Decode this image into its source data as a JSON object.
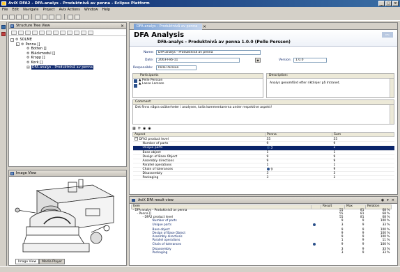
{
  "window": {
    "title": "AviX DFA2 - DFA-analys - Produktnivå av penna - Eclipse Platform",
    "controls": [
      "_",
      "□",
      "×"
    ]
  },
  "menu": {
    "items": [
      "File",
      "Edit",
      "Navigate",
      "Project",
      "Avix Actions",
      "Window",
      "Help"
    ]
  },
  "structure_view": {
    "title": "Structure Tree View",
    "tree": [
      {
        "label": "SOLME",
        "level": 0,
        "expander": "-"
      },
      {
        "label": "Penna []",
        "level": 1,
        "expander": "-"
      },
      {
        "label": "Botten []",
        "level": 2,
        "expander": ""
      },
      {
        "label": "Bläckmodul []",
        "level": 2,
        "expander": ""
      },
      {
        "label": "Kropp []",
        "level": 2,
        "expander": ""
      },
      {
        "label": "Kork []",
        "level": 2,
        "expander": ""
      },
      {
        "label": "DFA-analys - Produktnivå av penna",
        "level": 2,
        "expander": "",
        "selected": true
      }
    ]
  },
  "image_view": {
    "title": "Image View",
    "tabs": [
      "Image View",
      "Media Player"
    ]
  },
  "editor": {
    "tab_label": "DFA-analys - Produktnivå av penna",
    "heading": "DFA Analysis",
    "subheading": "DFA-analys - Produktnivå av penna 1.0.0 (Pelle Persson)",
    "logo_text": "DFA",
    "name_label": "Name:",
    "name_value": "DFA-analys - Produktnivå av penna",
    "date_label": "Date:",
    "date_value": "2003-Feb-11",
    "version_label": "Version:",
    "version_value": "1.0.0",
    "responsible_label": "Responsible:",
    "responsible_value": "Pelle Persson",
    "participants_label": "Participants",
    "participants": [
      "Pelle Persson",
      "Lasse Larsson"
    ],
    "description_label": "Description:",
    "description_value": "Analys genomförd efter riktlinjer på Intranet.",
    "comment_label": "Comment:",
    "comment_value": "Det finns några osäkerheter i analysen, kolla kommentarerna under respektive aspekt!",
    "aspect_table": {
      "columns": [
        "Aspect",
        "Penna",
        "Sum"
      ],
      "rows": [
        {
          "aspect": "DFA2 product level",
          "penna": "55",
          "sum": "55",
          "expander": "-"
        },
        {
          "aspect": "Number of parts",
          "penna": "9",
          "sum": "9"
        },
        {
          "aspect": "Unique parts",
          "penna": "3",
          "sum": "3",
          "selected": true,
          "marker": true
        },
        {
          "aspect": "Base object",
          "penna": "1",
          "sum": "1"
        },
        {
          "aspect": "Design of Base Object",
          "penna": "9",
          "sum": "9"
        },
        {
          "aspect": "Assembly directions",
          "penna": "9",
          "sum": "9"
        },
        {
          "aspect": "Parallel operations",
          "penna": "1",
          "sum": "1"
        },
        {
          "aspect": "Chain of tolerances",
          "penna": "9",
          "sum": "9",
          "marker": true
        },
        {
          "aspect": "Disassembly",
          "penna": "3",
          "sum": "3"
        },
        {
          "aspect": "Packaging",
          "penna": "3",
          "sum": "3"
        }
      ]
    }
  },
  "result_view": {
    "title": "AviX DFA result view",
    "columns": [
      "Item",
      "",
      "Result",
      "Max",
      "Relation"
    ],
    "rows": [
      {
        "item": "DFA-analys - Produktnivå av penna",
        "indent": 0,
        "result": "55",
        "max": "81",
        "relation": "68 %",
        "expander": "-"
      },
      {
        "item": "Penna []",
        "indent": 1,
        "result": "55",
        "max": "81",
        "relation": "68 %",
        "expander": "-"
      },
      {
        "item": "DFA2 product level",
        "indent": 2,
        "result": "55",
        "max": "81",
        "relation": "68 %",
        "expander": "-"
      },
      {
        "item": "Number of parts",
        "indent": 3,
        "result": "9",
        "max": "9",
        "relation": "100 %"
      },
      {
        "item": "Unique parts",
        "indent": 3,
        "result": "3",
        "max": "9",
        "relation": "33 %",
        "marker": true
      },
      {
        "item": "Base object",
        "indent": 3,
        "result": "9",
        "max": "9",
        "relation": "100 %"
      },
      {
        "item": "Design of Base Object",
        "indent": 3,
        "result": "9",
        "max": "9",
        "relation": "100 %"
      },
      {
        "item": "Assembly directions",
        "indent": 3,
        "result": "9",
        "max": "9",
        "relation": "100 %"
      },
      {
        "item": "Parallel operations",
        "indent": 3,
        "result": "1",
        "max": "9",
        "relation": "11 %"
      },
      {
        "item": "Chain of tolerances",
        "indent": 3,
        "result": "9",
        "max": "9",
        "relation": "100 %",
        "marker": true
      },
      {
        "item": "Disassembly",
        "indent": 3,
        "result": "3",
        "max": "9",
        "relation": "33 %"
      },
      {
        "item": "Packaging",
        "indent": 3,
        "result": "3",
        "max": "9",
        "relation": "33 %"
      }
    ]
  }
}
